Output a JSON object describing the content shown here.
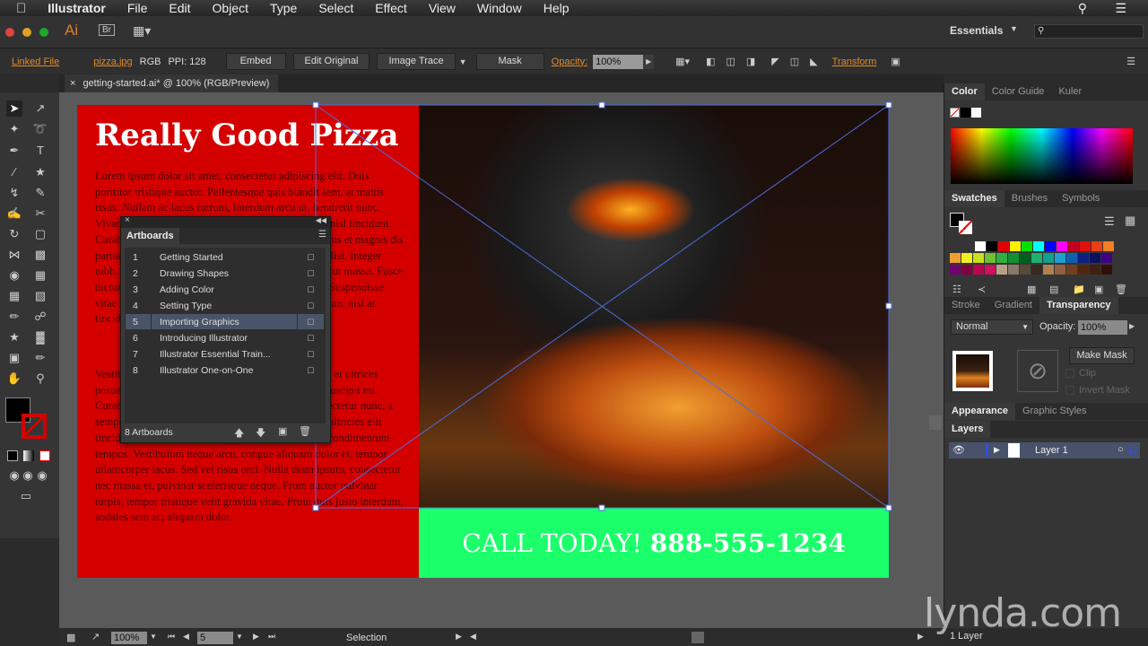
{
  "menubar": {
    "app": "Illustrator",
    "items": [
      "File",
      "Edit",
      "Object",
      "Type",
      "Select",
      "Effect",
      "View",
      "Window",
      "Help"
    ]
  },
  "appbar": {
    "logo": "Ai",
    "bridge": "Br",
    "workspace": "Essentials",
    "search_placeholder": ""
  },
  "control": {
    "linked_file": "Linked File",
    "filename": "pizza.jpg",
    "color_mode": "RGB",
    "ppi": "PPI: 128",
    "embed": "Embed",
    "edit_original": "Edit Original",
    "image_trace": "Image Trace",
    "mask": "Mask",
    "opacity_label": "Opacity:",
    "opacity": "100%",
    "transform": "Transform"
  },
  "document": {
    "tab": "getting-started.ai* @ 100% (RGB/Preview)"
  },
  "artwork": {
    "headline": "Really Good Pizza",
    "para1": "Lorem ipsum dolor sit amet, consectetur adipiscing elit. Duis porttitor tristique auctor. Pellentesque quis blandit sem, at mattis risus. Nullam ac lacus rutrum, interdum arcu ut, hendrerit nunc. Vivamus tincidunt dui at orci hendrerit, eget dictum nisl tincidunt. Curabitur at sem ut orci. Cum sociis natoque penatibus et magnis dis parturient montes, nascetur ridiculus mus. Nulla facilisi. Integer nibh, eu vulputate nisi. Praesent at ligula dui. Donec ut massa. Fusce dictum elit at metus volutpat, a rhoncus dui blandit. Suspendisse vitae eros nec lacus cursus placerat. Quisque accumsan, nisl at tincidunt cursus, lectus mi luctus orci dignissim.",
    "para2": "Vestibulum ante ipsum primis in faucibus orci luctus et ultrices posuere cubilia Curae; Sed et lacinia enim diam, at suscipit mi. Curabitur blandit, turpis id pulvinar, sed lorem consectetur nunc, a semper urna lorem nec. In venenatis varius ante, eu ultricies elit tincidunt nec. Curabitur. Duis posuere nisl ut lorem condimentum tempus. Vestibulum neque arcu, congue aliquam dolor et, tempor ullamcorper lacus. Sed vel risus orci. Nulla diam ipsum, consectetur nec massa et, pulvinar scelerisque neque. Proin auctor pulvinar turpis, tempor tristique velit gravida vitae. Proin quis justo interdum, sodales sem ac, aliquam dolor.",
    "call_prefix": "CALL TODAY!",
    "phone": "888-555-1234"
  },
  "artboards_panel": {
    "title": "Artboards",
    "count": "8 Artboards",
    "selected": 5,
    "items": [
      {
        "n": "1",
        "name": "Getting Started"
      },
      {
        "n": "2",
        "name": "Drawing Shapes"
      },
      {
        "n": "3",
        "name": "Adding Color"
      },
      {
        "n": "4",
        "name": "Setting Type"
      },
      {
        "n": "5",
        "name": "Importing Graphics"
      },
      {
        "n": "6",
        "name": "Introducing Illustrator"
      },
      {
        "n": "7",
        "name": "Illustrator Essential Train..."
      },
      {
        "n": "8",
        "name": "Illustrator One-on-One"
      }
    ]
  },
  "right_panels": {
    "color_tabs": [
      "Color",
      "Color Guide",
      "Kuler"
    ],
    "swatch_tabs": [
      "Swatches",
      "Brushes",
      "Symbols"
    ],
    "swatches": [
      "#ffffff",
      "#000000",
      "#e00000",
      "#ffee00",
      "#00e000",
      "#00ffff",
      "#0000ff",
      "#ff00ff",
      "#c00020",
      "#e01010",
      "#e84010",
      "#f08020",
      "#f0a030",
      "#f0f020",
      "#c8e020",
      "#70c030",
      "#30b040",
      "#109030",
      "#006020",
      "#20b070",
      "#10a090",
      "#20a0d0",
      "#1060b0",
      "#102080",
      "#101060",
      "#400080",
      "#700070",
      "#800040",
      "#c00050",
      "#d01060",
      "#b8a088",
      "#887868",
      "#584838",
      "#382820",
      "#b08050",
      "#906040",
      "#704020",
      "#502810",
      "#402010",
      "#301008"
    ],
    "trans_tabs": [
      "Stroke",
      "Gradient",
      "Transparency"
    ],
    "blend_mode": "Normal",
    "opacity_label": "Opacity:",
    "opacity": "100%",
    "make_mask": "Make Mask",
    "clip": "Clip",
    "invert_mask": "Invert Mask",
    "appearance_tabs": [
      "Appearance",
      "Graphic Styles"
    ],
    "layers_tab": "Layers",
    "layer_name": "Layer 1",
    "layers_count": "1 Layer"
  },
  "status": {
    "zoom": "100%",
    "artboard": "5",
    "tool": "Selection"
  },
  "watermark": "lynda.com"
}
